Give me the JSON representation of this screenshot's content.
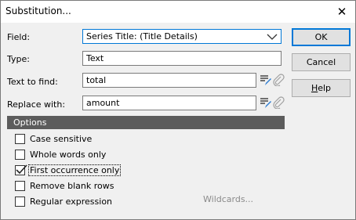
{
  "dialog": {
    "title": "Substitution...",
    "close_glyph": "✕"
  },
  "fields": {
    "field_label": "Field:",
    "field_value": "Series Title: (Title Details)",
    "type_label": "Type:",
    "type_value": "Text",
    "find_label": "Text to find:",
    "find_value": "total",
    "replace_label": "Replace with:",
    "replace_value": "amount"
  },
  "buttons": {
    "ok": "OK",
    "cancel": "Cancel",
    "help_mnemonic": "H",
    "help_rest": "elp"
  },
  "options": {
    "header": "Options",
    "items": [
      {
        "label": "Case sensitive",
        "checked": false
      },
      {
        "label": "Whole words only",
        "checked": false
      },
      {
        "label": "First occurrence only",
        "checked": true
      },
      {
        "label": "Remove blank rows",
        "checked": false
      },
      {
        "label": "Regular expression",
        "checked": false
      }
    ],
    "wildcards_link": "Wildcards..."
  },
  "icons": {
    "edit_list": "edit-list-icon",
    "attach": "paperclip-icon",
    "dropdown": "chevron-down-icon"
  },
  "colors": {
    "accent": "#0078d7",
    "options_bar": "#5c5c5c",
    "disabled_text": "#8a8a8a"
  }
}
